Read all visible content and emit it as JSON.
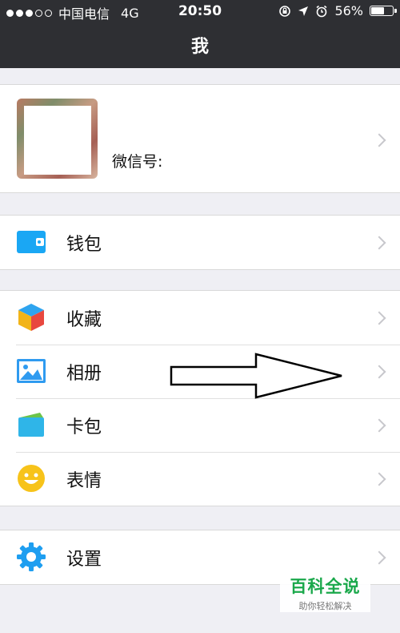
{
  "status_bar": {
    "carrier": "中国电信",
    "network": "4G",
    "time": "20:50",
    "battery": "56%",
    "battery_level": 0.56
  },
  "header": {
    "title": "我"
  },
  "profile": {
    "wechat_id_label": "微信号:"
  },
  "groups": [
    {
      "items": [
        {
          "label": "钱包",
          "icon": "wallet-icon",
          "color": "#1aa7f4"
        }
      ]
    },
    {
      "items": [
        {
          "label": "收藏",
          "icon": "favorites-cube-icon"
        },
        {
          "label": "相册",
          "icon": "album-picture-icon",
          "color": "#2f9bf0"
        },
        {
          "label": "卡包",
          "icon": "card-package-icon",
          "color": "#2fb5e8"
        },
        {
          "label": "表情",
          "icon": "smiley-icon",
          "color": "#f7c31a"
        }
      ]
    },
    {
      "items": [
        {
          "label": "设置",
          "icon": "settings-gear-icon",
          "color": "#1e9ef0"
        }
      ]
    }
  ],
  "watermark": {
    "title": "百科全说",
    "subtitle": "助你轻松解决"
  },
  "colors": {
    "topbar": "#2e2f33",
    "background": "#efeff4",
    "watermark_green": "#1aa84b"
  }
}
